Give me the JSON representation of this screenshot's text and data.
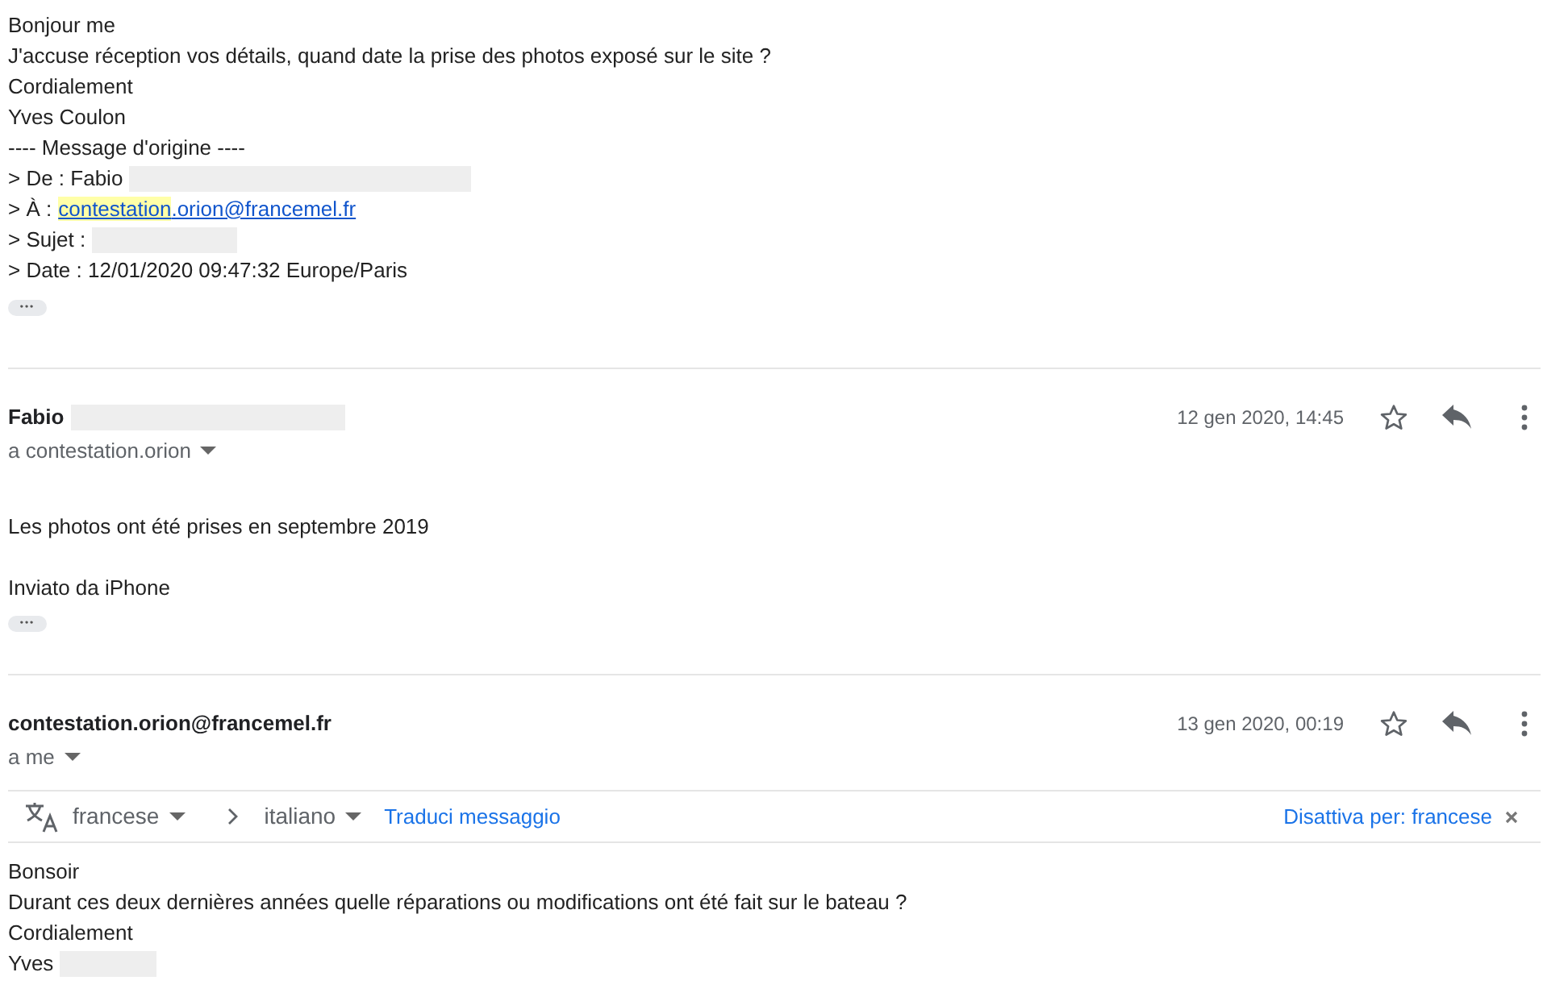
{
  "quoted_message": {
    "lines": [
      {
        "kind": "text",
        "text": "Bonjour me"
      },
      {
        "kind": "text",
        "text": "J'accuse réception vos détails, quand date la prise des photos exposé sur le site ?"
      },
      {
        "kind": "text",
        "text": "Cordialement"
      },
      {
        "kind": "text",
        "text": "Yves Coulon"
      },
      {
        "kind": "text",
        "text": "---- Message d'origine ----"
      },
      {
        "kind": "redacted",
        "text": "> De : Fabio"
      },
      {
        "kind": "link",
        "text": "> À :",
        "highlight": "contestation",
        "rest": ".orion@francemel.fr"
      },
      {
        "kind": "redacted",
        "text": "> Sujet :"
      },
      {
        "kind": "text",
        "text": "> Date : 12/01/2020 09:47:32 Europe/Paris"
      }
    ],
    "ellipsis": "•••"
  },
  "messages": [
    {
      "sender": "Fabio",
      "sender_redacted": true,
      "recipient": "a contestation.orion",
      "date": "12 gen 2020, 14:45",
      "starred": false,
      "paragraphs": [
        [
          "Les photos ont été prises en septembre 2019"
        ],
        [
          "Inviato da iPhone"
        ]
      ],
      "ellipsis": "•••"
    },
    {
      "sender": "contestation.orion@francemel.fr",
      "sender_redacted": false,
      "recipient": "a me",
      "date": "13 gen 2020, 00:19",
      "starred": false,
      "translation_bar": {
        "source": "francese",
        "target": "italiano",
        "action": "Traduci messaggio",
        "disable": "Disattiva per: francese"
      },
      "paragraphs": [
        [
          "Bonsoir",
          "Durant ces deux dernières années quelle réparations ou modifications ont été fait sur le bateau ?",
          "Cordialement"
        ]
      ],
      "signature": "Yves"
    }
  ]
}
